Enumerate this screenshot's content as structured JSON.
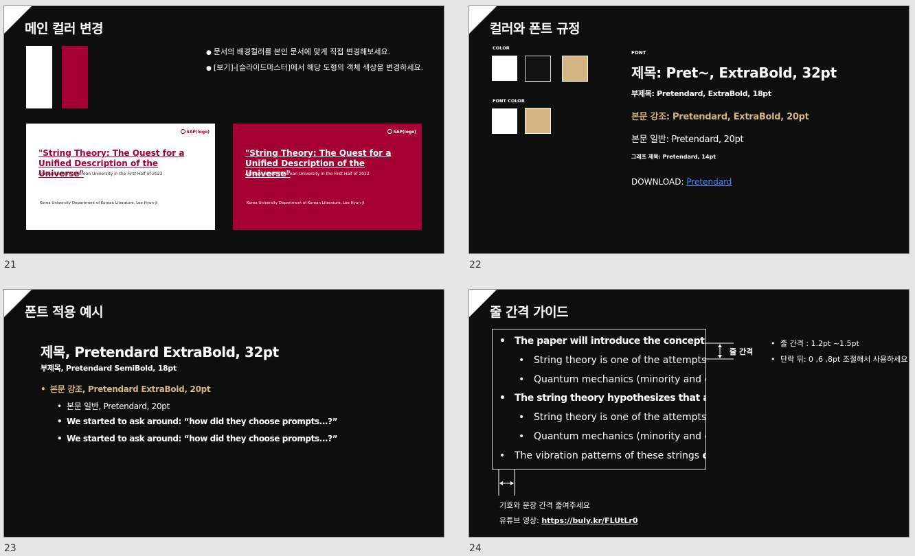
{
  "slide21": {
    "number": "21",
    "title": "메인 컬러 변경",
    "bullets": [
      "문서의 배경컬러를 본인 문서에 맞게 직접 변경해보세요.",
      "[보기]-[슬라이드마스터]에서 해당 도형의 객체 색상을 변경하세요."
    ],
    "bullet_mark": "●",
    "colors": {
      "white": "#ffffff",
      "accent": "#a50034"
    },
    "thumb": {
      "logo": "SAP(logo)",
      "heading_line1": "\"String Theory: The Quest for a",
      "heading_line2": "Unified Description of the Universe\"",
      "subtitle": "Announcement of Korean University in the First Half of 2022",
      "footer": "Korea University Department of Korean Literature, Lee Hyun-Ji"
    }
  },
  "slide22": {
    "number": "22",
    "title": "컬러와 폰트 규정",
    "color_label": "COLOR",
    "font_color_label": "FONT COLOR",
    "font_label": "FONT",
    "swatches": {
      "white": "#ffffff",
      "black": "#111111",
      "beige": "#d4b483"
    },
    "font_title": "제목: Pret~, ExtraBold, 32pt",
    "font_subtitle": "부제목: Pretendard, ExtraBold, 18pt",
    "font_emphasis": "본문 강조: Pretendard, ExtraBold, 20pt",
    "font_body": "본문 일반: Pretendard, 20pt",
    "font_graph": "그래프 제목: Pretendard, 14pt",
    "download_label": "DOWNLOAD:",
    "download_link": "Pretendard"
  },
  "slide23": {
    "number": "23",
    "title": "폰트 적용 예시",
    "heading": "제목, Pretendard ExtraBold, 32pt",
    "subheading": "부제목, Pretendard SemiBold, 18pt",
    "emphasis": "본문 강조, Pretendard ExtraBold, 20pt",
    "body1": "본문 일반, Pretendard, 20pt",
    "body2": "We started to ask around: “how did they choose prompts...?”",
    "body3": "We started to ask around: “how did they choose prompts...?”",
    "bullet": "•"
  },
  "slide24": {
    "number": "24",
    "title": "줄 간격 가이드",
    "bullet": "•",
    "lines": {
      "l1": "The paper will introduce the concept and",
      "l2": "String theory is one of the attempts to",
      "l3": "Quantum mechanics (minority and ele",
      "l4": "The string theory hypothesizes that all",
      "l5": "String theory is one of the attempts to",
      "l6": "Quantum mechanics (minority and ele",
      "l7a": "The vibration patterns of these strings ",
      "l7b": "de"
    },
    "spacing_label": "줄 간격",
    "notes": [
      "줄 간격 : 1.2pt ~1.5pt",
      "단락 뒤: 0 ,6 ,8pt 조절해서 사용하세요"
    ],
    "gap_note": "기호와 문장 간격 줄여주세요",
    "youtube_label": "유튜브 영상: ",
    "youtube_link": "https://buly.kr/FLUtLr0"
  }
}
